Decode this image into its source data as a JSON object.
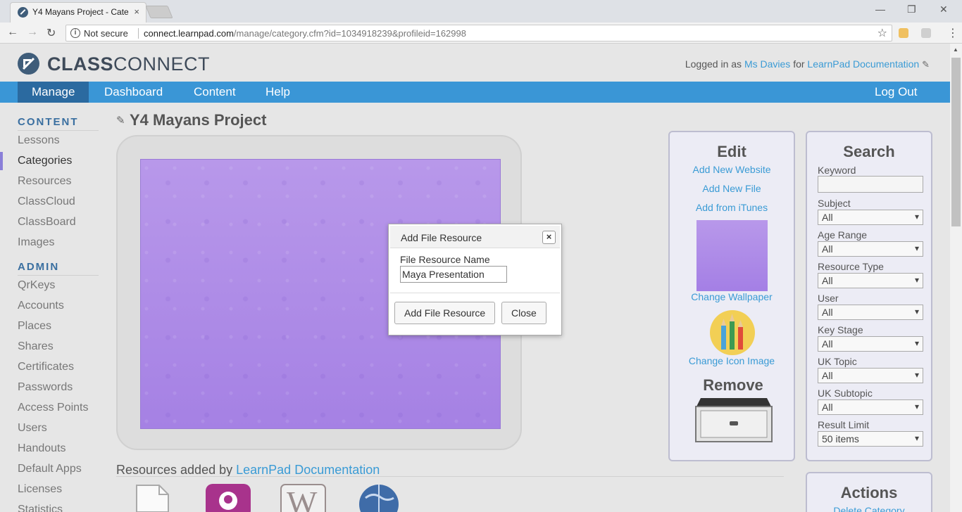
{
  "browser": {
    "tab_title": "Y4 Mayans Project - Cate",
    "tab_close": "×",
    "not_secure": "Not secure",
    "url_host": "connect.learnpad.com",
    "url_path": "/manage/category.cfm?id=1034918239&profileid=162998"
  },
  "header": {
    "logo_bold": "CLASS",
    "logo_light": "CONNECT",
    "logged_prefix": "Logged in as",
    "user": "Ms Davies",
    "for": "for",
    "org": "LearnPad Documentation"
  },
  "nav": {
    "items": [
      "Manage",
      "Dashboard",
      "Content",
      "Help"
    ],
    "logout": "Log Out"
  },
  "sidebar": {
    "content_head": "CONTENT",
    "content_items": [
      "Lessons",
      "Categories",
      "Resources",
      "ClassCloud",
      "ClassBoard",
      "Images"
    ],
    "admin_head": "ADMIN",
    "admin_items": [
      "QrKeys",
      "Accounts",
      "Places",
      "Shares",
      "Certificates",
      "Passwords",
      "Access Points",
      "Users",
      "Handouts",
      "Default Apps",
      "Licenses",
      "Statistics"
    ],
    "active": "Categories"
  },
  "main": {
    "title": "Y4 Mayans Project",
    "resources_prefix": "Resources added by",
    "resources_owner": "LearnPad Documentation"
  },
  "modal": {
    "title": "Add File Resource",
    "close": "×",
    "field_label": "File Resource Name",
    "field_value": "Maya Presentation",
    "submit": "Add File Resource",
    "cancel": "Close"
  },
  "edit_panel": {
    "title": "Edit",
    "add_website": "Add New Website",
    "add_file": "Add New File",
    "add_itunes": "Add from iTunes",
    "change_wallpaper": "Change Wallpaper",
    "change_icon": "Change Icon Image",
    "remove_title": "Remove"
  },
  "search_panel": {
    "title": "Search",
    "keyword_label": "Keyword",
    "fields": [
      {
        "label": "Subject",
        "value": "All"
      },
      {
        "label": "Age Range",
        "value": "All"
      },
      {
        "label": "Resource Type",
        "value": "All"
      },
      {
        "label": "User",
        "value": "All"
      },
      {
        "label": "Key Stage",
        "value": "All"
      },
      {
        "label": "UK Topic",
        "value": "All"
      },
      {
        "label": "UK Subtopic",
        "value": "All"
      },
      {
        "label": "Result Limit",
        "value": "50 items"
      }
    ]
  },
  "actions_panel": {
    "title": "Actions",
    "delete": "Delete Category"
  },
  "colors": {
    "accent": "#3a96d6",
    "nav_active": "#2b6aa0",
    "link": "#3a9bd5",
    "wallpaper": "#b893e8"
  }
}
